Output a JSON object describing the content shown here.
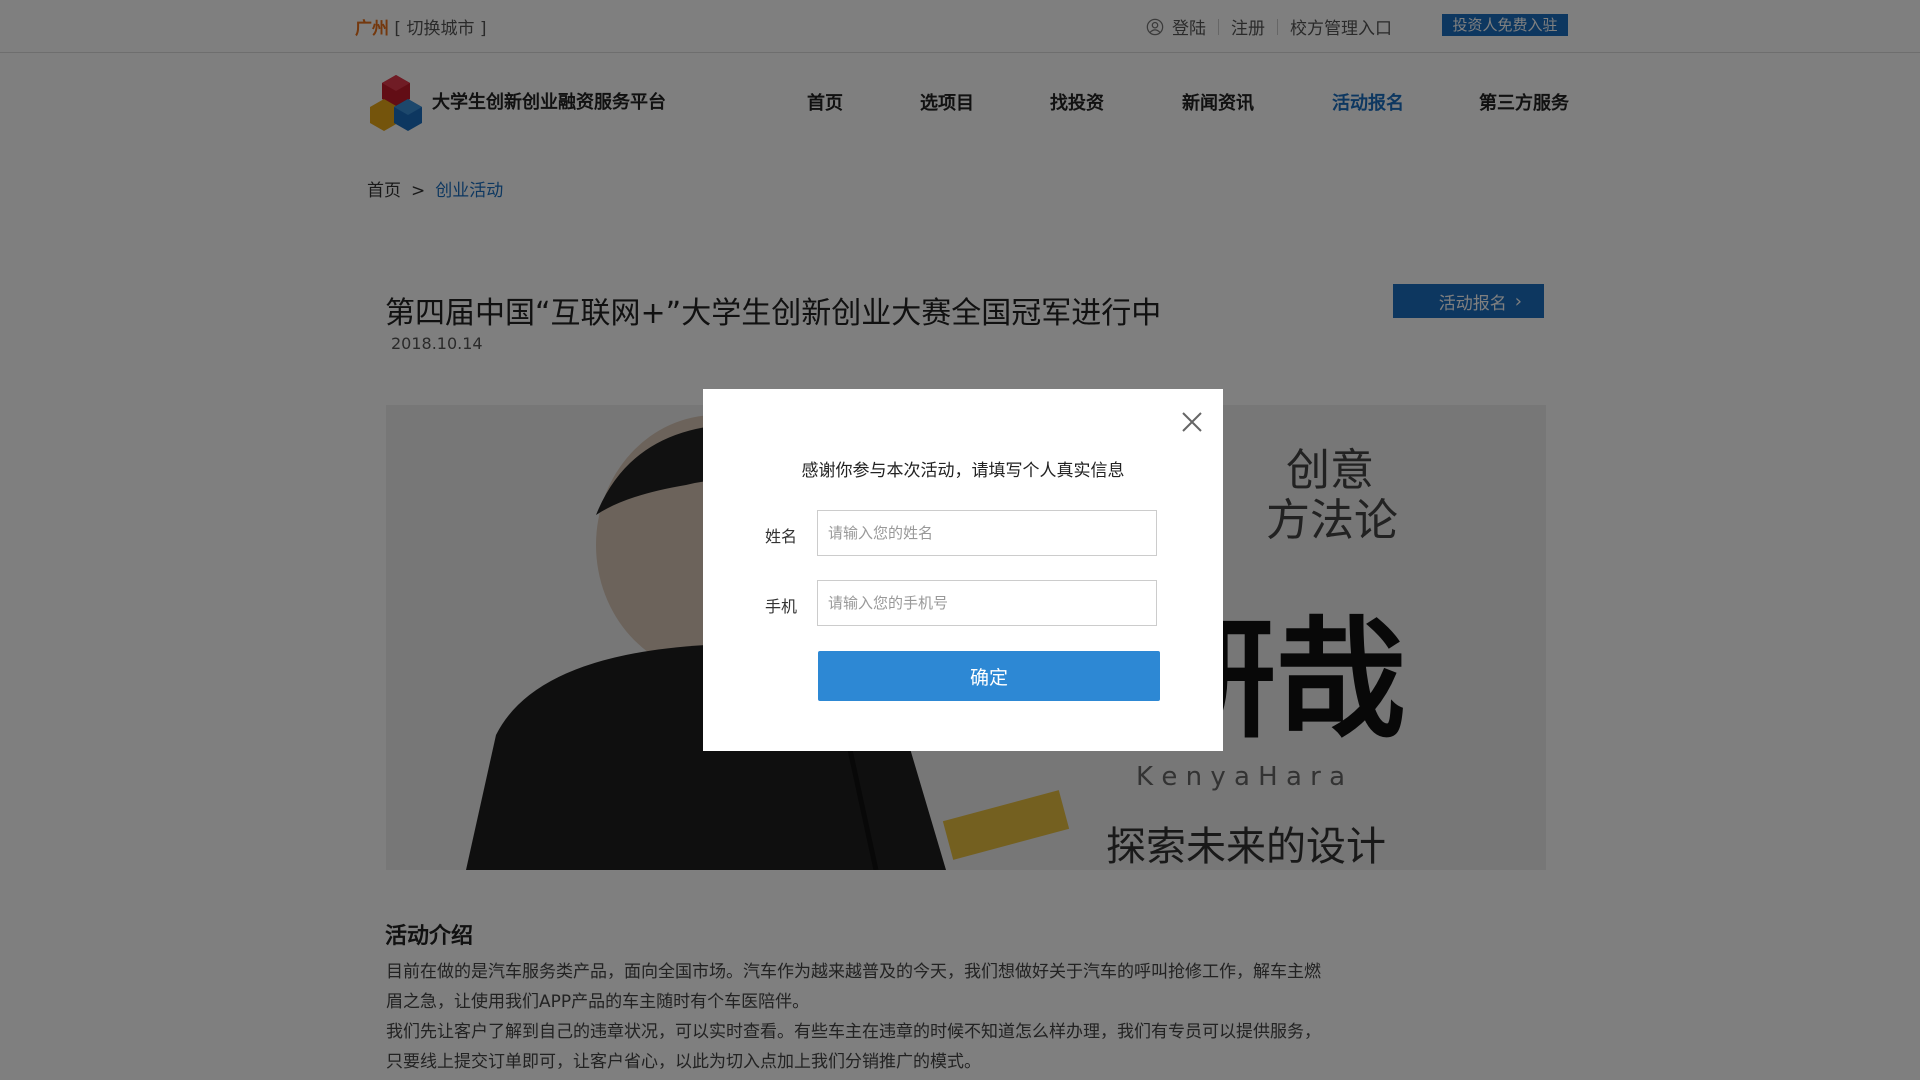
{
  "topbar": {
    "city": "广州",
    "switch_city": "[ 切换城市 ]",
    "login": "登陆",
    "register": "注册",
    "school_entry": "校方管理入口",
    "investor_badge": "投资人免费入驻"
  },
  "header": {
    "brand": "大学生创新创业融资服务平台",
    "nav": [
      "首页",
      "选项目",
      "找投资",
      "新闻资讯",
      "活动报名",
      "第三方服务"
    ]
  },
  "breadcrumb": {
    "home": "首页",
    "separator": ">",
    "current": "创业活动"
  },
  "article": {
    "title": "第四届中国“互联网+”大学生创新创业大赛全国冠军进行中",
    "date": "2018.10.14",
    "signup_button": "活动报名",
    "banner_text": {
      "top": "创意",
      "top2": "方法论",
      "big": "研哉",
      "latin": "K e n y a   H a r a",
      "bottom": "探索未来的设计"
    },
    "section_title": "活动介绍",
    "paragraphs": [
      "目前在做的是汽车服务类产品，面向全国市场。汽车作为越来越普及的今天，我们想做好关于汽车的呼叫抢修工作，解车主燃",
      "眉之急，让使用我们APP产品的车主随时有个车医陪伴。",
      "我们先让客户了解到自己的违章状况，可以实时查看。有些车主在违章的时候不知道怎么样办理，我们有专员可以提供服务，",
      "只要线上提交订单即可，让客户省心，以此为切入点加上我们分销推广的模式。"
    ]
  },
  "modal": {
    "message": "感谢你参与本次活动，请填写个人真实信息",
    "name_label": "姓名",
    "name_placeholder": "请输入您的姓名",
    "phone_label": "手机",
    "phone_placeholder": "请输入您的手机号",
    "confirm": "确定"
  },
  "colors": {
    "accent": "#1a6fc1",
    "button": "#2d88d4",
    "city": "#e8701a"
  }
}
